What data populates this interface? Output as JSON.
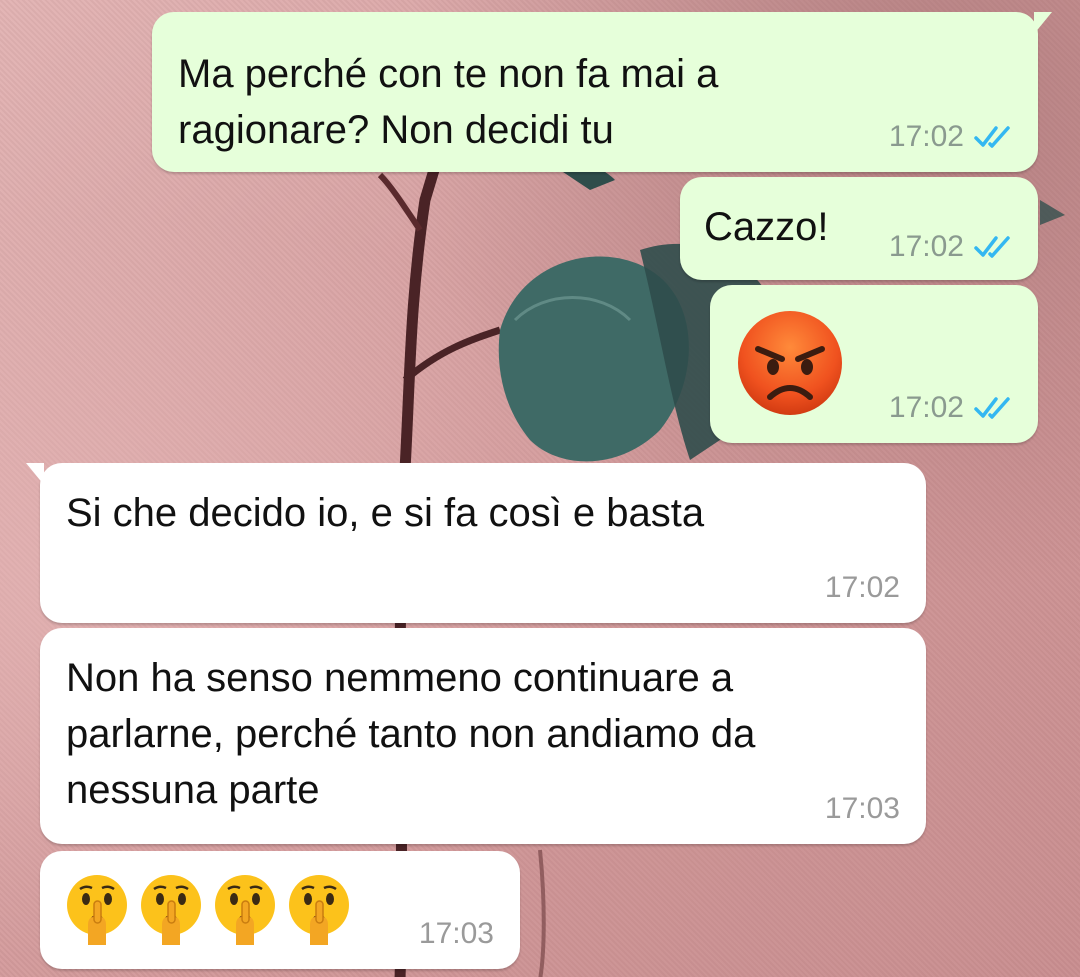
{
  "chat": {
    "messages": [
      {
        "direction": "outgoing",
        "text": "Ma perché con te non fa mai a\nragionare? Non decidi tu",
        "time": "17:02",
        "status": "read",
        "status_icon": "double-check-icon"
      },
      {
        "direction": "outgoing",
        "text": "Cazzo!",
        "time": "17:02",
        "status": "read",
        "status_icon": "double-check-icon"
      },
      {
        "direction": "outgoing",
        "emoji": "angry-face-icon",
        "time": "17:02",
        "status": "read",
        "status_icon": "double-check-icon"
      },
      {
        "direction": "incoming",
        "text": "Si che decido io, e si fa così e basta",
        "time": "17:02"
      },
      {
        "direction": "incoming",
        "text": "Non ha senso nemmeno continuare a\nparlarne, perché tanto non andiamo da\nnessuna parte",
        "time": "17:03"
      },
      {
        "direction": "incoming",
        "emoji": [
          "shushing-face-icon",
          "shushing-face-icon",
          "shushing-face-icon",
          "shushing-face-icon"
        ],
        "time": "17:03"
      }
    ]
  },
  "colors": {
    "outgoing_bubble": "#e6ffda",
    "incoming_bubble": "#ffffff",
    "read_ticks": "#34b7f1"
  }
}
